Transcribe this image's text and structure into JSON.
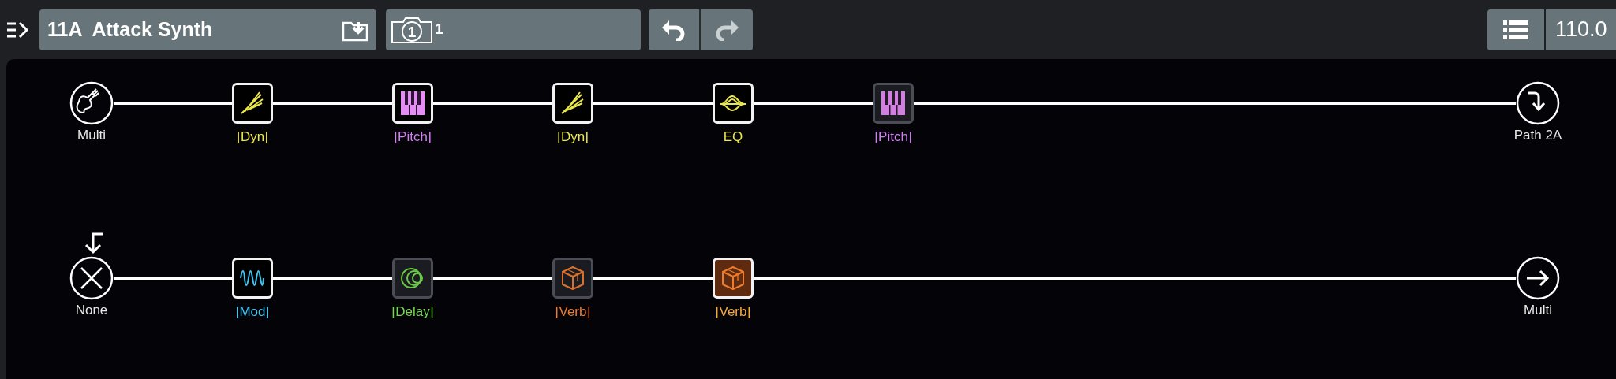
{
  "toolbar": {
    "preset": "11A  Attack Synth",
    "snapshot_icon_number": "1",
    "snapshot": "1",
    "tempo": "110.0"
  },
  "paths": [
    {
      "input": {
        "kind": "multi",
        "label": "Multi"
      },
      "blocks": [
        {
          "kind": "dyn",
          "label": "[Dyn]",
          "bypassed": false,
          "selected": false
        },
        {
          "kind": "pitch",
          "label": "[Pitch]",
          "bypassed": false,
          "selected": false
        },
        {
          "kind": "dyn",
          "label": "[Dyn]",
          "bypassed": false,
          "selected": false
        },
        {
          "kind": "eq",
          "label": "EQ",
          "bypassed": false,
          "selected": false
        },
        {
          "kind": "pitch",
          "label": "[Pitch]",
          "bypassed": true,
          "selected": false
        }
      ],
      "output": {
        "kind": "split",
        "label": "Path 2A"
      }
    },
    {
      "input": {
        "kind": "none",
        "label": "None"
      },
      "blocks": [
        {
          "kind": "mod",
          "label": "[Mod]",
          "bypassed": false,
          "selected": false
        },
        {
          "kind": "delay",
          "label": "[Delay]",
          "bypassed": true,
          "selected": false
        },
        {
          "kind": "verb",
          "label": "[Verb]",
          "bypassed": true,
          "selected": false
        },
        {
          "kind": "verb",
          "label": "[Verb]",
          "bypassed": false,
          "selected": true
        }
      ],
      "output": {
        "kind": "arrow",
        "label": "Multi"
      }
    }
  ]
}
